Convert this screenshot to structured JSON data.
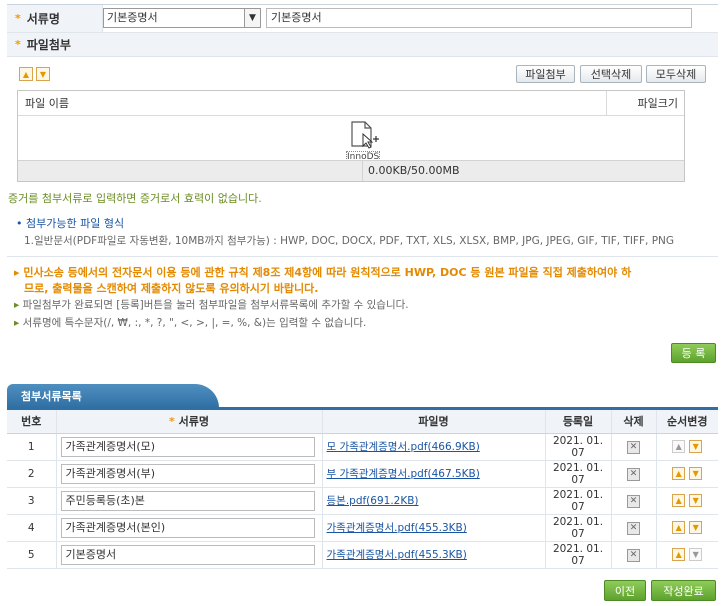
{
  "form": {
    "doc_name_label": "서류명",
    "select_value": "기본증명서",
    "input_value": "기본증명서",
    "attach_label": "파일첨부"
  },
  "upload": {
    "attach_btn": "파일첨부",
    "delete_selected_btn": "선택삭제",
    "delete_all_btn": "모두삭제",
    "col_filename": "파일 이름",
    "col_filesize": "파일크기",
    "drop_icon_label": "InnoDS",
    "usage": "0.00KB/50.00MB"
  },
  "notes": {
    "evidence_note": "증거를 첨부서류로 입력하면 증거로서 효력이 없습니다.",
    "formats_title": "첨부가능한 파일 형식",
    "formats_detail": "1.일반문서(PDF파일로 자동변환, 10MB까지 첨부가능) : HWP, DOC, DOCX, PDF, TXT, XLS, XLSX, BMP, JPG, JPEG, GIF, TIF, TIFF, PNG",
    "warning_line1": "민사소송 등에서의 전자문서 이용 등에 관한 규칙 제8조 제4항에 따라 원칙적으로 HWP, DOC 등 원본 파일을 직접 제출하여야 하",
    "warning_line2": "므로, 출력물을 스캔하여 제출하지 않도록 유의하시기 바랍니다.",
    "info1": "파일첨부가 완료되면 [등록]버튼을 눌러 첨부파일을 첨부서류목록에 추가할 수 있습니다.",
    "info2": "서류명에 특수문자(/, ₩, :, *, ?, \", <, >, |, =, %, &)는 입력할 수 없습니다."
  },
  "register_btn": "등 록",
  "list": {
    "tab_title": "첨부서류목록",
    "headers": {
      "no": "번호",
      "doc_name": "서류명",
      "file_name": "파일명",
      "date": "등록일",
      "delete": "삭제",
      "order": "순서변경"
    },
    "rows": [
      {
        "no": "1",
        "doc_name": "가족관계증명서(모)",
        "file_name": "모 가족관계증명서.pdf(466.9KB)",
        "date": "2021. 01. 07"
      },
      {
        "no": "2",
        "doc_name": "가족관계증명서(부)",
        "file_name": "부 가족관계증명서.pdf(467.5KB)",
        "date": "2021. 01. 07"
      },
      {
        "no": "3",
        "doc_name": "주민등록등(초)본",
        "file_name": "등본.pdf(691.2KB)",
        "date": "2021. 01. 07"
      },
      {
        "no": "4",
        "doc_name": "가족관계증명서(본인)",
        "file_name": "가족관계증명서.pdf(455.3KB)",
        "date": "2021. 01. 07"
      },
      {
        "no": "5",
        "doc_name": "기본증명서",
        "file_name": "가족관계증명서.pdf(455.3KB)",
        "date": "2021. 01. 07"
      }
    ]
  },
  "footer": {
    "prev_btn": "이전",
    "done_btn": "작성완료"
  },
  "colors": {
    "accent_orange": "#f39800",
    "tab_blue": "#2f6fa3",
    "button_green": "#5ea22e",
    "link_blue": "#1a55a3"
  }
}
